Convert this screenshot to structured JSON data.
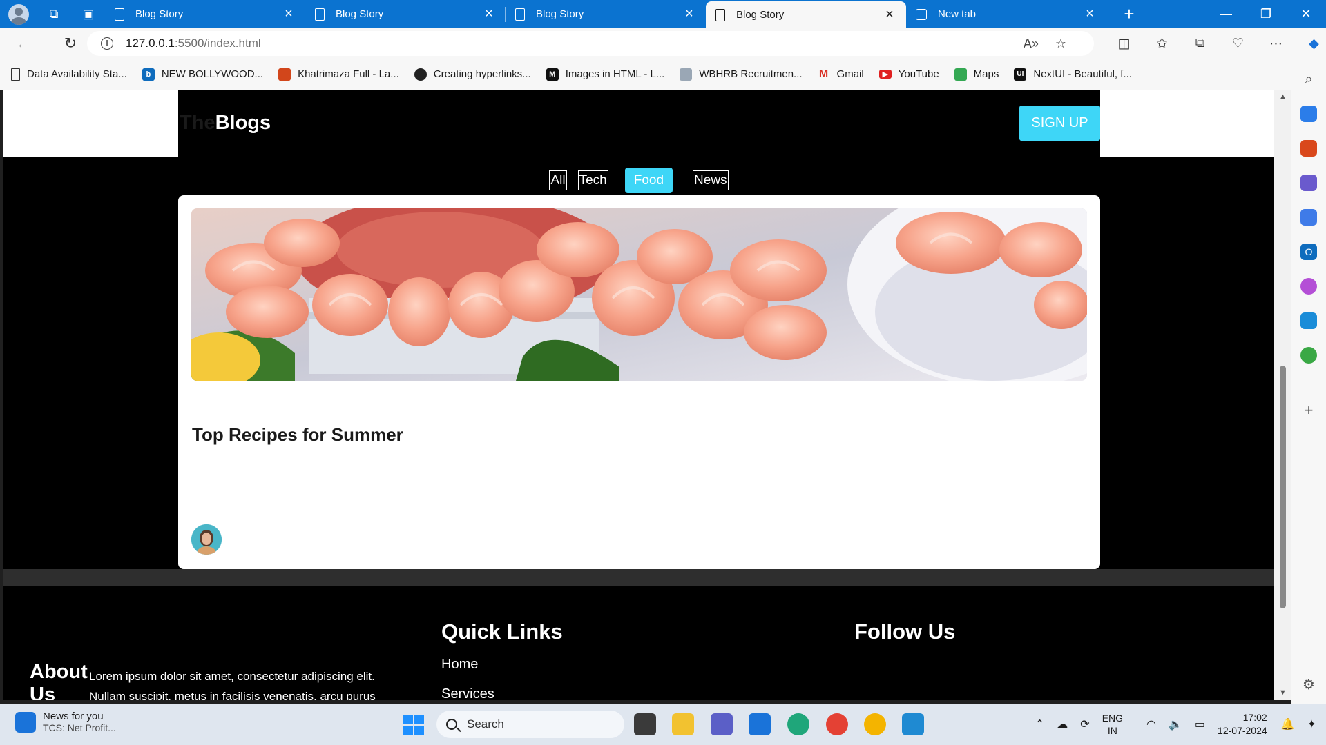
{
  "browser": {
    "tabs": [
      {
        "label": "Blog Story",
        "active": false
      },
      {
        "label": "Blog Story",
        "active": false
      },
      {
        "label": "Blog Story",
        "active": false
      },
      {
        "label": "Blog Story",
        "active": true
      },
      {
        "label": "New tab",
        "active": false
      }
    ],
    "url_host": "127.0.0.1",
    "url_rest": ":5500/index.html",
    "bookmarks": [
      {
        "label": "Data Availability Sta...",
        "icon": "page-icon"
      },
      {
        "label": "NEW BOLLYWOOD...",
        "icon": "bing-icon"
      },
      {
        "label": "Khatrimaza Full - La...",
        "icon": "khatrimaza-icon"
      },
      {
        "label": "Creating hyperlinks...",
        "icon": "mdn-icon"
      },
      {
        "label": "Images in HTML - L...",
        "icon": "mdn-m-icon"
      },
      {
        "label": "WBHRB Recruitmen...",
        "icon": "wbhrb-icon"
      },
      {
        "label": "Gmail",
        "icon": "gmail-icon"
      },
      {
        "label": "YouTube",
        "icon": "youtube-icon"
      },
      {
        "label": "Maps",
        "icon": "maps-icon"
      },
      {
        "label": "NextUI - Beautiful, f...",
        "icon": "nextui-icon"
      }
    ]
  },
  "site": {
    "logo_prefix": "The",
    "logo_main": "Blogs",
    "signup_label": "SIGN UP",
    "filters": [
      {
        "label": "All",
        "active": false
      },
      {
        "label": "Tech",
        "active": false
      },
      {
        "label": "Food",
        "active": true
      },
      {
        "label": "News",
        "active": false
      }
    ],
    "card": {
      "title": "Top Recipes for Summer",
      "image": "shrimp-cocktail-photo"
    },
    "footer": {
      "about_heading": "About Us",
      "about_text": "Lorem ipsum dolor sit amet, consectetur adipiscing elit. Nullam suscipit, metus in facilisis venenatis, arcu purus",
      "quick_links_heading": "Quick Links",
      "quick_links": [
        "Home",
        "Services"
      ],
      "follow_heading": "Follow Us"
    },
    "accent_color": "#3ed6f7"
  },
  "taskbar": {
    "news_title": "News for you",
    "news_sub": "TCS: Net Profit...",
    "search_placeholder": "Search",
    "lang_line1": "ENG",
    "lang_line2": "IN",
    "time": "17:02",
    "date": "12-07-2024"
  }
}
